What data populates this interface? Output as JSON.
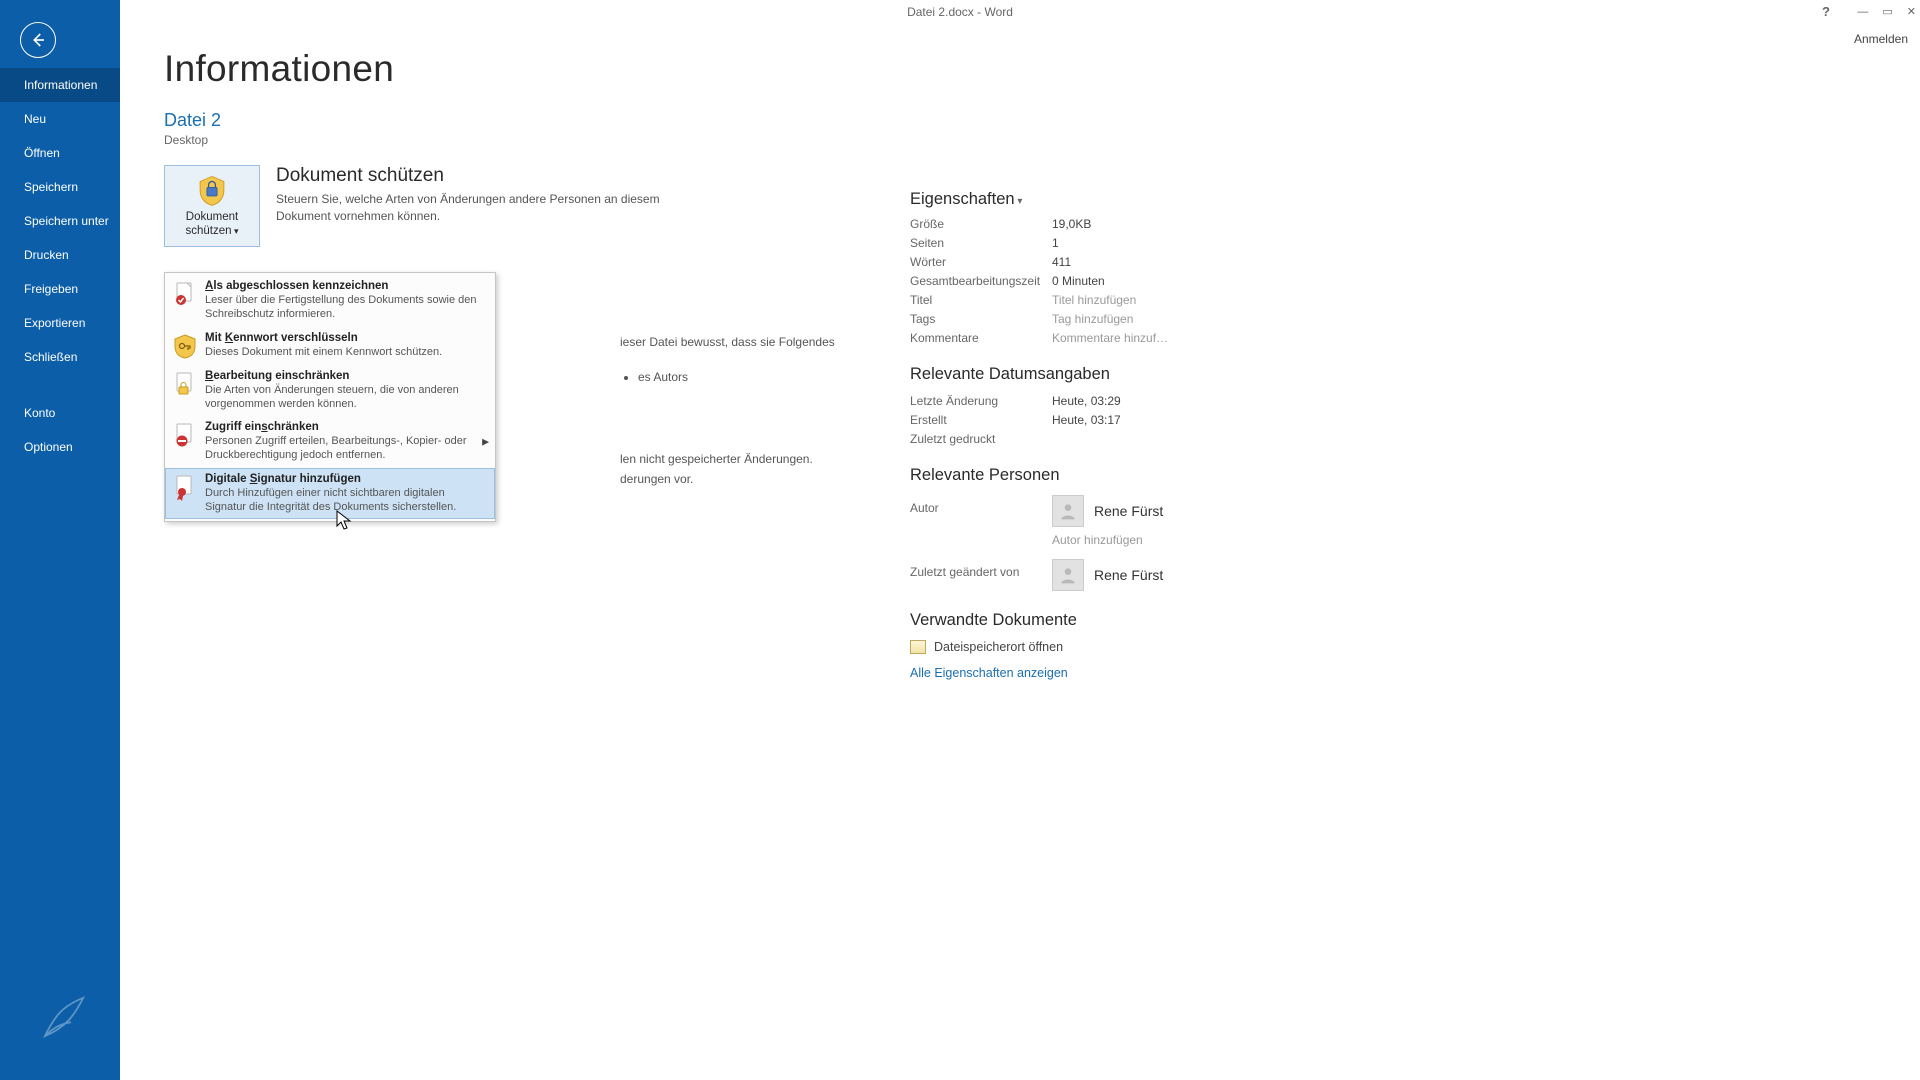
{
  "window": {
    "title": "Datei 2.docx - Word",
    "signin": "Anmelden"
  },
  "sidebar": {
    "items": [
      "Informationen",
      "Neu",
      "Öffnen",
      "Speichern",
      "Speichern unter",
      "Drucken",
      "Freigeben",
      "Exportieren",
      "Schließen"
    ],
    "bottom_items": [
      "Konto",
      "Optionen"
    ]
  },
  "page": {
    "title": "Informationen",
    "doc_name": "Datei 2",
    "doc_location": "Desktop"
  },
  "protect": {
    "button": "Dokument\nschützen",
    "title": "Dokument schützen",
    "desc": "Steuern Sie, welche Arten von Änderungen andere Personen an diesem Dokument vornehmen können."
  },
  "bg_snippets": {
    "line1": "ieser Datei bewusst, dass sie Folgendes",
    "bullet": "es Autors",
    "line2": "len nicht gespeicherter Änderungen.",
    "line3": "derungen vor."
  },
  "menu": [
    {
      "title": "Als abgeschlossen kennzeichnen",
      "u": 0,
      "desc": "Leser über die Fertigstellung des Dokuments sowie den Schreibschutz informieren.",
      "arrow": false,
      "hover": false
    },
    {
      "title": "Mit Kennwort verschlüsseln",
      "u": 4,
      "desc": "Dieses Dokument mit einem Kennwort schützen.",
      "arrow": false,
      "hover": false
    },
    {
      "title": "Bearbeitung einschränken",
      "u": 0,
      "desc": "Die Arten von Änderungen steuern, die von anderen vorgenommen werden können.",
      "arrow": false,
      "hover": false
    },
    {
      "title": "Zugriff einschränken",
      "u": 11,
      "desc": "Personen Zugriff erteilen, Bearbeitungs-, Kopier- oder Druckberechtigung jedoch entfernen.",
      "arrow": true,
      "hover": false
    },
    {
      "title": "Digitale Signatur hinzufügen",
      "u": 9,
      "desc": "Durch Hinzufügen einer nicht sichtbaren digitalen Signatur die Integrität des Dokuments sicherstellen.",
      "arrow": false,
      "hover": true
    }
  ],
  "properties": {
    "header": "Eigenschaften",
    "rows": [
      {
        "label": "Größe",
        "value": "19,0KB"
      },
      {
        "label": "Seiten",
        "value": "1"
      },
      {
        "label": "Wörter",
        "value": "411"
      },
      {
        "label": "Gesamtbearbeitungszeit",
        "value": "0 Minuten"
      },
      {
        "label": "Titel",
        "value": "Titel hinzufügen",
        "ph": true
      },
      {
        "label": "Tags",
        "value": "Tag hinzufügen",
        "ph": true
      },
      {
        "label": "Kommentare",
        "value": "Kommentare hinzuf…",
        "ph": true,
        "trunc": true
      }
    ],
    "dates_header": "Relevante Datumsangaben",
    "dates": [
      {
        "label": "Letzte Änderung",
        "value": "Heute, 03:29"
      },
      {
        "label": "Erstellt",
        "value": "Heute, 03:17"
      },
      {
        "label": "Zuletzt gedruckt",
        "value": ""
      }
    ],
    "people_header": "Relevante Personen",
    "author_label": "Autor",
    "author_name": "Rene Fürst",
    "add_author": "Autor hinzufügen",
    "modified_by_label": "Zuletzt geändert von",
    "modified_by_name": "Rene Fürst",
    "related_header": "Verwandte Dokumente",
    "open_location": "Dateispeicherort öffnen",
    "show_all": "Alle Eigenschaften anzeigen"
  }
}
